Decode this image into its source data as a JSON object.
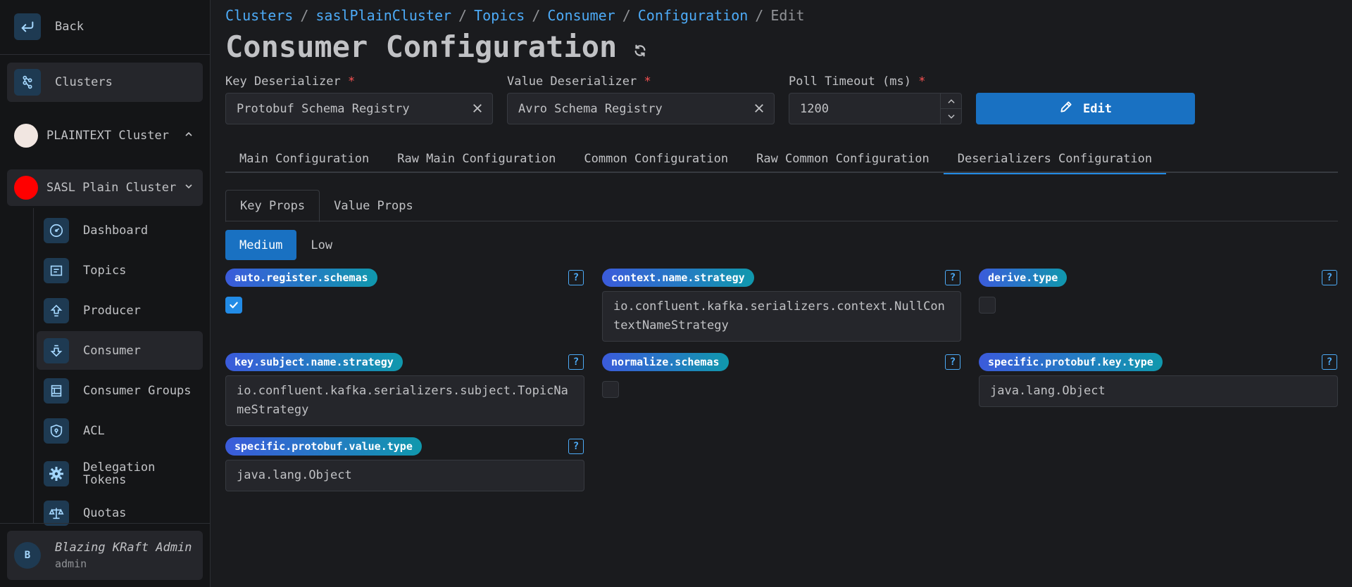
{
  "sidebar": {
    "back_label": "Back",
    "clusters_label": "Clusters",
    "cluster_items": [
      {
        "label": "PLAINTEXT Cluster",
        "color": "#f1e6e1"
      },
      {
        "label": "SASL Plain Cluster",
        "color": "#ff0000"
      }
    ],
    "nav": [
      {
        "label": "Dashboard",
        "icon": "dashboard-icon"
      },
      {
        "label": "Topics",
        "icon": "file-text-icon"
      },
      {
        "label": "Producer",
        "icon": "upload-arrow-icon"
      },
      {
        "label": "Consumer",
        "icon": "download-arrow-icon"
      },
      {
        "label": "Consumer Groups",
        "icon": "columns-icon"
      },
      {
        "label": "ACL",
        "icon": "shield-icon"
      },
      {
        "label": "Delegation Tokens",
        "icon": "gear-icon"
      },
      {
        "label": "Quotas",
        "icon": "scale-icon"
      }
    ],
    "user": {
      "initial": "B",
      "name": "Blazing KRaft Admin",
      "role": "admin"
    }
  },
  "breadcrumb": {
    "items": [
      "Clusters",
      "saslPlainCluster",
      "Topics",
      "Consumer",
      "Configuration"
    ],
    "current": "Edit",
    "separator": "/"
  },
  "page": {
    "title": "Consumer Configuration"
  },
  "form": {
    "key_deserializer": {
      "label": "Key Deserializer",
      "required": "*",
      "value": "Protobuf Schema Registry"
    },
    "value_deserializer": {
      "label": "Value Deserializer",
      "required": "*",
      "value": "Avro Schema Registry"
    },
    "poll_timeout": {
      "label": "Poll Timeout (ms)",
      "required": "*",
      "value": "1200"
    },
    "edit_label": "Edit"
  },
  "tabs": [
    "Main Configuration",
    "Raw Main Configuration",
    "Common Configuration",
    "Raw Common Configuration",
    "Deserializers Configuration"
  ],
  "active_tab": "Deserializers Configuration",
  "subtabs": [
    "Key Props",
    "Value Props"
  ],
  "importance": [
    "Medium",
    "Low"
  ],
  "props": {
    "auto_register_schemas": {
      "name": "auto.register.schemas",
      "checked": true
    },
    "context_name_strategy": {
      "name": "context.name.strategy",
      "value": "io.confluent.kafka.serializers.context.NullContextNameStrategy"
    },
    "derive_type": {
      "name": "derive.type",
      "checked": false
    },
    "key_subject_name_strategy": {
      "name": "key.subject.name.strategy",
      "value": "io.confluent.kafka.serializers.subject.TopicNameStrategy"
    },
    "normalize_schemas": {
      "name": "normalize.schemas",
      "checked": false
    },
    "specific_protobuf_key_type": {
      "name": "specific.protobuf.key.type",
      "value": "java.lang.Object"
    },
    "specific_protobuf_value_type": {
      "name": "specific.protobuf.value.type",
      "value": "java.lang.Object"
    }
  },
  "help_glyph": "?"
}
